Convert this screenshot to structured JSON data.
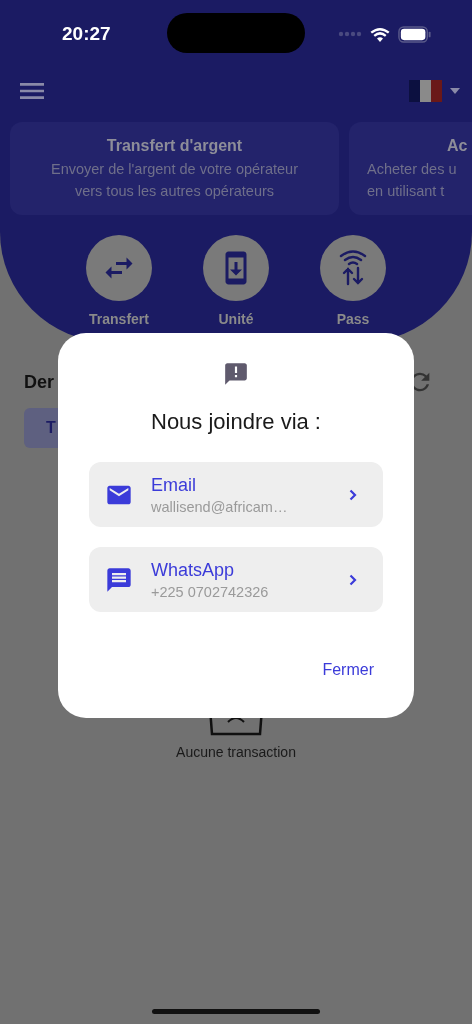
{
  "status_bar": {
    "time": "20:27"
  },
  "header": {
    "cards": [
      {
        "title": "Transfert d'argent",
        "lines": [
          "Envoyer de l'argent de votre opérateur",
          "vers tous les autres opérateurs"
        ]
      },
      {
        "title": "Ac",
        "lines": [
          "Acheter des u",
          "en utilisant t"
        ]
      }
    ],
    "actions": [
      {
        "kind": "transfer",
        "label": "Transfert"
      },
      {
        "kind": "airtime",
        "label": "Unité"
      },
      {
        "kind": "data",
        "label": "Pass"
      }
    ]
  },
  "section": {
    "title": "Der",
    "filter_button": "T"
  },
  "empty_state": {
    "message": "Aucune transaction"
  },
  "dialog": {
    "title": "Nous joindre via :",
    "options": [
      {
        "kind": "email",
        "label": "Email",
        "value": "wallisend@africam…"
      },
      {
        "kind": "whatsapp",
        "label": "WhatsApp",
        "value": "+225 0702742326"
      }
    ],
    "close": "Fermer"
  }
}
